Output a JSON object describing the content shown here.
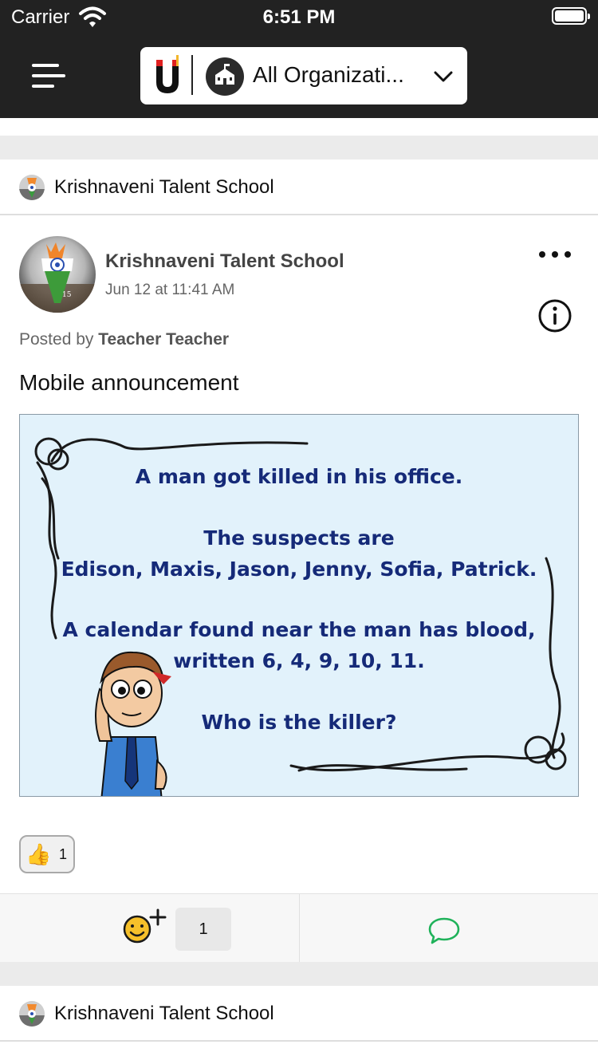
{
  "status_bar": {
    "carrier": "Carrier",
    "time": "6:51 PM"
  },
  "nav": {
    "org_selector_label": "All Organizati...",
    "menu_icon": "hamburger-icon",
    "app_logo": "magnet-logo",
    "org_icon": "school-building-icon"
  },
  "feed": {
    "groups": [
      {
        "name": "Krishnaveni Talent School"
      },
      {
        "name": "Krishnaveni Talent School"
      }
    ],
    "post": {
      "author": "Krishnaveni Talent School",
      "timestamp": "Jun 12 at 11:41 AM",
      "posted_by_prefix": "Posted by",
      "posted_by_name": "Teacher Teacher",
      "text": "Mobile announcement",
      "image_lines": [
        "A man got killed in his office.",
        "The suspects are",
        "Edison, Maxis, Jason, Jenny, Sofia, Patrick.",
        "A calendar found near the man has blood,",
        "written 6, 4, 9, 10, 11.",
        "Who is the killer?"
      ],
      "reactions": [
        {
          "emoji": "👍",
          "count": "1"
        }
      ],
      "actions": {
        "reaction_count": "1",
        "add_reaction_icon": "smiley-plus-icon",
        "comment_icon": "speech-bubble-icon"
      }
    }
  },
  "colors": {
    "nav_bg": "#222222",
    "divider_bg": "#ebebeb",
    "comment_green": "#1fb25a",
    "puzzle_text": "#152a78",
    "puzzle_bg": "#e2f2fb"
  }
}
